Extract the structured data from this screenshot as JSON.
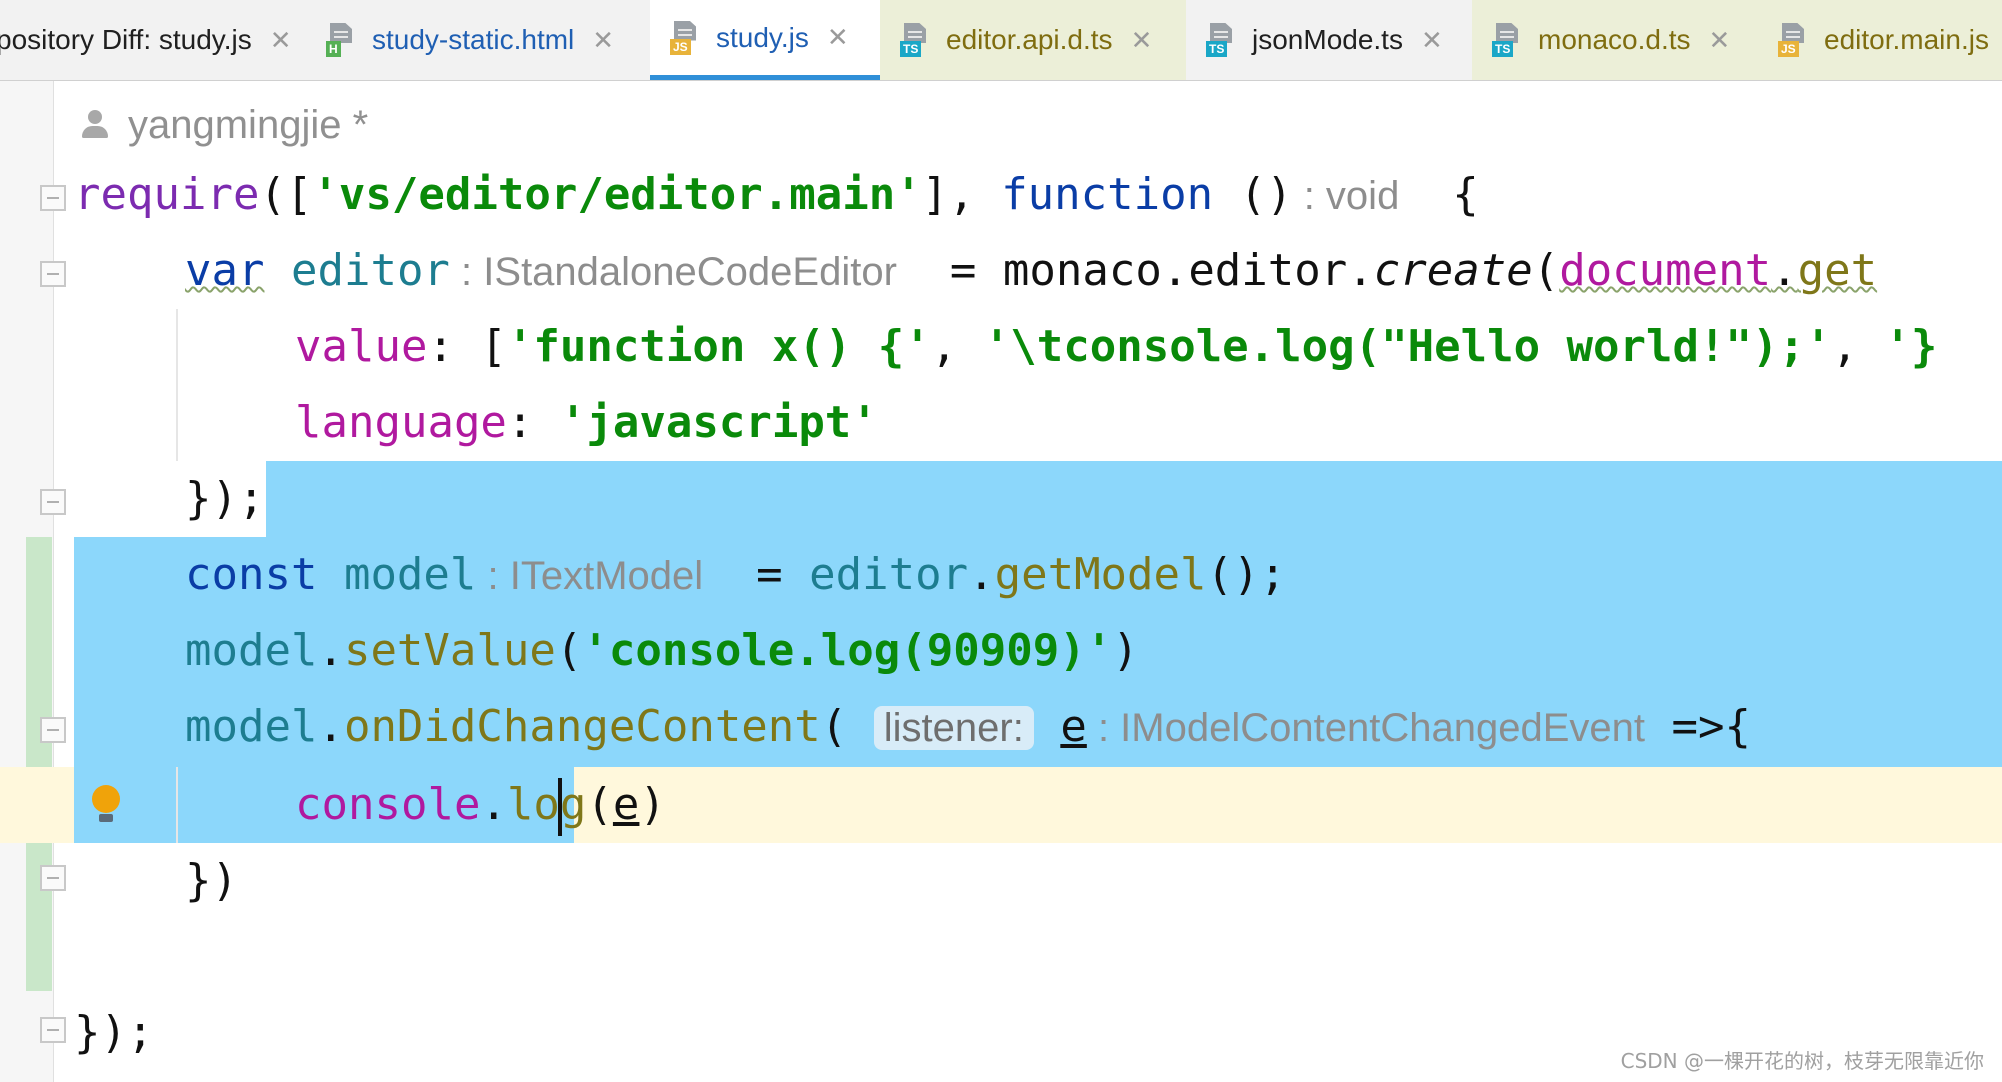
{
  "tabs": [
    {
      "label": "pository Diff: study.js",
      "icon": "none",
      "close": "✕"
    },
    {
      "label": "study-static.html",
      "icon": "html-file-icon",
      "badge": "H",
      "close": "✕"
    },
    {
      "label": "study.js",
      "icon": "js-file-icon",
      "badge": "JS",
      "close": "✕",
      "active": true
    },
    {
      "label": "editor.api.d.ts",
      "icon": "ts-file-icon",
      "badge": "TS",
      "close": "✕"
    },
    {
      "label": "jsonMode.ts",
      "icon": "ts-file-icon",
      "badge": "TS",
      "close": "✕"
    },
    {
      "label": "monaco.d.ts",
      "icon": "ts-file-icon",
      "badge": "TS",
      "close": "✕"
    },
    {
      "label": "editor.main.js",
      "icon": "js-file-icon",
      "badge": "JS"
    }
  ],
  "editor": {
    "author": "yangmingjie *",
    "colors": {
      "selection": "#8cd7fb",
      "caret_line": "#fff8dc",
      "change_bar": "#c9e7c9"
    },
    "code": {
      "l1": {
        "a": "require",
        "b": "([",
        "c": "'vs/editor/editor.main'",
        "d": "], ",
        "e": "function",
        "f": " ()",
        "g": " : void",
        "h": "  {"
      },
      "l2": {
        "a": "var",
        "b": " ",
        "c": "editor",
        "d": " : IStandaloneCodeEditor",
        "e": "  = monaco.editor.",
        "f": "create",
        "g": "(",
        "h": "document",
        "i": ".",
        "j": "get"
      },
      "l3": {
        "a": "value",
        "b": ": [",
        "c": "'function x() {'",
        "d": ", ",
        "e": "'\\tconsole.log(\"Hello world!\");'",
        "f": ", ",
        "g": "'}"
      },
      "l4": {
        "a": "language",
        "b": ": ",
        "c": "'javascript'"
      },
      "l5": {
        "a": "});"
      },
      "l6": {
        "a": "const",
        "b": " ",
        "c": "model",
        "d": " : ITextModel",
        "e": "  = ",
        "f": "editor",
        "g": ".",
        "h": "getModel",
        "i": "();"
      },
      "l7": {
        "a": "model",
        "b": ".",
        "c": "setValue",
        "d": "(",
        "e": "'console.log(90909)'",
        "f": ")"
      },
      "l8": {
        "a": "model",
        "b": ".",
        "c": "onDidChangeContent",
        "d": "( ",
        "e": "listener:",
        "f": " ",
        "g": "e",
        "h": " : IModelContentChangedEvent",
        "i": " =>{"
      },
      "l9": {
        "a": "console",
        "b": ".",
        "c": "lo",
        "d": "g",
        "e": "(",
        "f": "e",
        "g": ")"
      },
      "l10": {
        "a": "})"
      },
      "l12": {
        "a": "});"
      }
    }
  },
  "watermark": "CSDN @一棵开花的树，枝芽无限靠近你"
}
